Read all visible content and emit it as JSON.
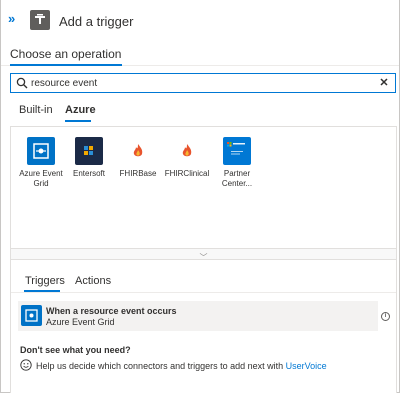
{
  "header": {
    "title": "Add a trigger"
  },
  "operation": {
    "title": "Choose an operation"
  },
  "search": {
    "value": "resource event",
    "placeholder": "Search connectors and triggers"
  },
  "tabs": [
    {
      "label": "Built-in",
      "selected": false
    },
    {
      "label": "Azure",
      "selected": true
    }
  ],
  "connectors": [
    {
      "label_line1": "Azure Event",
      "label_line2": "Grid",
      "icon": "azure-event-grid-icon",
      "color": "#0072c6"
    },
    {
      "label_line1": "Entersoft",
      "label_line2": "",
      "icon": "entersoft-icon",
      "color": "#1b2a47"
    },
    {
      "label_line1": "FHIRBase",
      "label_line2": "",
      "icon": "fhir-flame-icon",
      "color": "#e8542d"
    },
    {
      "label_line1": "FHIRClinical",
      "label_line2": "",
      "icon": "fhir-flame-icon",
      "color": "#e8542d"
    },
    {
      "label_line1": "Partner",
      "label_line2": "Center...",
      "icon": "microsoft-partner-center-icon",
      "color": "#0078d4"
    }
  ],
  "bottom_tabs": [
    {
      "label": "Triggers",
      "selected": true
    },
    {
      "label": "Actions",
      "selected": false
    }
  ],
  "result": {
    "title": "When a resource event occurs",
    "subtitle": "Azure Event Grid"
  },
  "help": {
    "heading": "Don't see what you need?",
    "text": "Help us decide which connectors and triggers to add next with ",
    "link": "UserVoice"
  },
  "colors": {
    "accent": "#0078d4",
    "event_grid": "#0072c6"
  }
}
